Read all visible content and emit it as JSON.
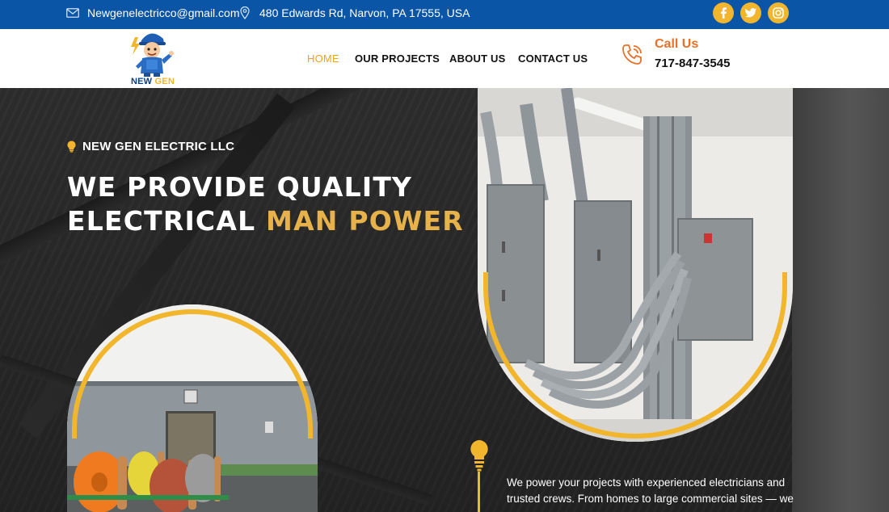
{
  "topbar": {
    "email": "Newgenelectricco@gmail.com",
    "address": "480 Edwards Rd, Narvon, PA 17555, USA",
    "social": [
      "facebook-icon",
      "twitter-icon",
      "instagram-icon"
    ]
  },
  "header": {
    "logo_text_1": "NEW",
    "logo_text_2": "GEN",
    "nav": {
      "home": "HOME",
      "projects": "OUR PROJECTS",
      "about": "ABOUT US",
      "contact": "CONTACT US"
    },
    "call_label": "Call Us",
    "call_number": "717-847-3545"
  },
  "hero": {
    "eyebrow": "NEW GEN ELECTRIC LLC",
    "headline_line1": "WE PROVIDE QUALITY",
    "headline_line2_white": "ELECTRICAL",
    "headline_line2_accent": "MAN POWER",
    "paragraph": "We power your projects with experienced electricians and trusted crews. From homes to large commercial sites — we"
  },
  "colors": {
    "topbar": "#0b55a6",
    "accent_gold": "#f2b62c",
    "headline_accent": "#e7b24a",
    "nav_active": "#f0a31c",
    "call_orange": "#e8702b"
  }
}
